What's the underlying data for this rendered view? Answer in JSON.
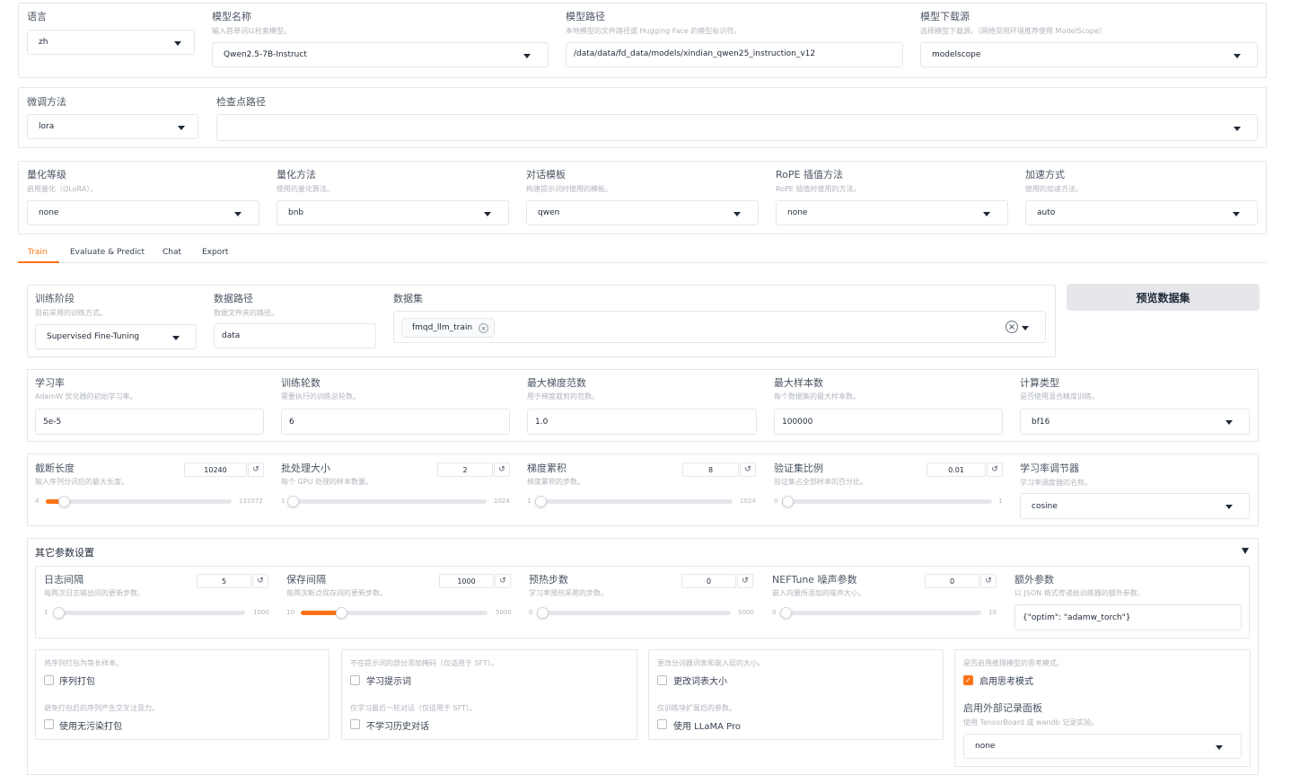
{
  "top": {
    "language": {
      "label": "语言",
      "value": "zh"
    },
    "model_name": {
      "label": "模型名称",
      "hint": "输入首单词以检索模型。",
      "value": "Qwen2.5-7B-Instruct"
    },
    "model_path": {
      "label": "模型路径",
      "hint": "本地模型的文件路径或 Hugging Face 的模型标识符。",
      "value": "/data/data/fd_data/models/xindian_qwen25_instruction_v12"
    },
    "model_source": {
      "label": "模型下载源",
      "hint": "选择模型下载源。（网络受限环境推荐使用 ModelScope）",
      "value": "modelscope"
    }
  },
  "finetune": {
    "method": {
      "label": "微调方法",
      "value": "lora"
    },
    "checkpoint": {
      "label": "检查点路径",
      "value": ""
    }
  },
  "quant": {
    "bit": {
      "label": "量化等级",
      "hint": "启用量化（QLoRA）。",
      "value": "none"
    },
    "method": {
      "label": "量化方法",
      "hint": "使用的量化算法。",
      "value": "bnb"
    },
    "template": {
      "label": "对话模板",
      "hint": "构建提示词时使用的模板。",
      "value": "qwen"
    },
    "rope": {
      "label": "RoPE 插值方法",
      "hint": "RoPE 插值时使用的方法。",
      "value": "none"
    },
    "booster": {
      "label": "加速方式",
      "hint": "使用的加速方法。",
      "value": "auto"
    }
  },
  "tabs": [
    "Train",
    "Evaluate & Predict",
    "Chat",
    "Export"
  ],
  "active_tab": 0,
  "data_section": {
    "stage": {
      "label": "训练阶段",
      "hint": "目前采用的训练方式。",
      "value": "Supervised Fine-Tuning"
    },
    "data_dir": {
      "label": "数据路径",
      "hint": "数据文件夹的路径。",
      "value": "data"
    },
    "dataset": {
      "label": "数据集",
      "chips": [
        "fmqd_llm_train"
      ]
    },
    "preview_button": "预览数据集"
  },
  "hyper": {
    "lr": {
      "label": "学习率",
      "hint": "AdamW 优化器的初始学习率。",
      "value": "5e-5"
    },
    "epochs": {
      "label": "训练轮数",
      "hint": "需要执行的训练总轮数。",
      "value": "6"
    },
    "max_grad": {
      "label": "最大梯度范数",
      "hint": "用于梯度裁剪的范数。",
      "value": "1.0"
    },
    "max_samples": {
      "label": "最大样本数",
      "hint": "每个数据集的最大样本数。",
      "value": "100000"
    },
    "compute_type": {
      "label": "计算类型",
      "hint": "是否使用混合精度训练。",
      "value": "bf16"
    }
  },
  "sliders_a": [
    {
      "label": "截断长度",
      "hint": "输入序列分词后的最大长度。",
      "value": "10240",
      "min": "4",
      "max": "131072",
      "fraction": 0.078
    },
    {
      "label": "批处理大小",
      "hint": "每个 GPU 处理的样本数量。",
      "value": "2",
      "min": "1",
      "max": "1024",
      "fraction": 0.001
    },
    {
      "label": "梯度累积",
      "hint": "梯度累积的步数。",
      "value": "8",
      "min": "1",
      "max": "1024",
      "fraction": 0.007
    },
    {
      "label": "验证集比例",
      "hint": "验证集占全部样本的百分比。",
      "value": "0.01",
      "min": "0",
      "max": "1",
      "fraction": 0.01
    }
  ],
  "scheduler": {
    "label": "学习率调节器",
    "hint": "学习率调度器的名称。",
    "value": "cosine"
  },
  "extra": {
    "title": "其它参数设置",
    "sliders": [
      {
        "label": "日志间隔",
        "hint": "每两次日志输出间的更新步数。",
        "value": "5",
        "min": "1",
        "max": "1000",
        "fraction": 0.004
      },
      {
        "label": "保存间隔",
        "hint": "每两次断点保存间的更新步数。",
        "value": "1000",
        "min": "10",
        "max": "5000",
        "fraction": 0.198
      },
      {
        "label": "预热步数",
        "hint": "学习率预热采用的步数。",
        "value": "0",
        "min": "0",
        "max": "5000",
        "fraction": 0
      },
      {
        "label": "NEFTune 噪声参数",
        "hint": "嵌入向量所添加的噪声大小。",
        "value": "0",
        "min": "0",
        "max": "10",
        "fraction": 0
      }
    ],
    "extra_args": {
      "label": "额外参数",
      "hint": "以 JSON 格式传递给训练器的额外参数。",
      "value": "{\"optim\": \"adamw_torch\"}"
    },
    "checks": {
      "packing_hint": "将序列打包为等长样本。",
      "packing": "序列打包",
      "nocontam_hint": "避免打包后的序列产生交叉注意力。",
      "nocontam": "使用无污染打包",
      "trainprompt_hint": "不在提示词的部分添加掩码（仅适用于 SFT）。",
      "trainprompt": "学习提示词",
      "lastturn_hint": "仅学习最后一轮对话（仅适用于 SFT）。",
      "lastturn": "不学习历史对话",
      "resize_hint": "更改分词器词表和嵌入层的大小。",
      "resize": "更改词表大小",
      "llamapro_hint": "仅训练块扩展后的参数。",
      "llamapro": "使用 LLaMA Pro",
      "thinking_hint": "是否启用推理模型的思考模式。",
      "thinking": "启用思考模式",
      "thinking_on": true
    },
    "report": {
      "label": "启用外部记录面板",
      "hint": "使用 TensorBoard 或 wandb 记录实验。",
      "value": "none"
    }
  }
}
